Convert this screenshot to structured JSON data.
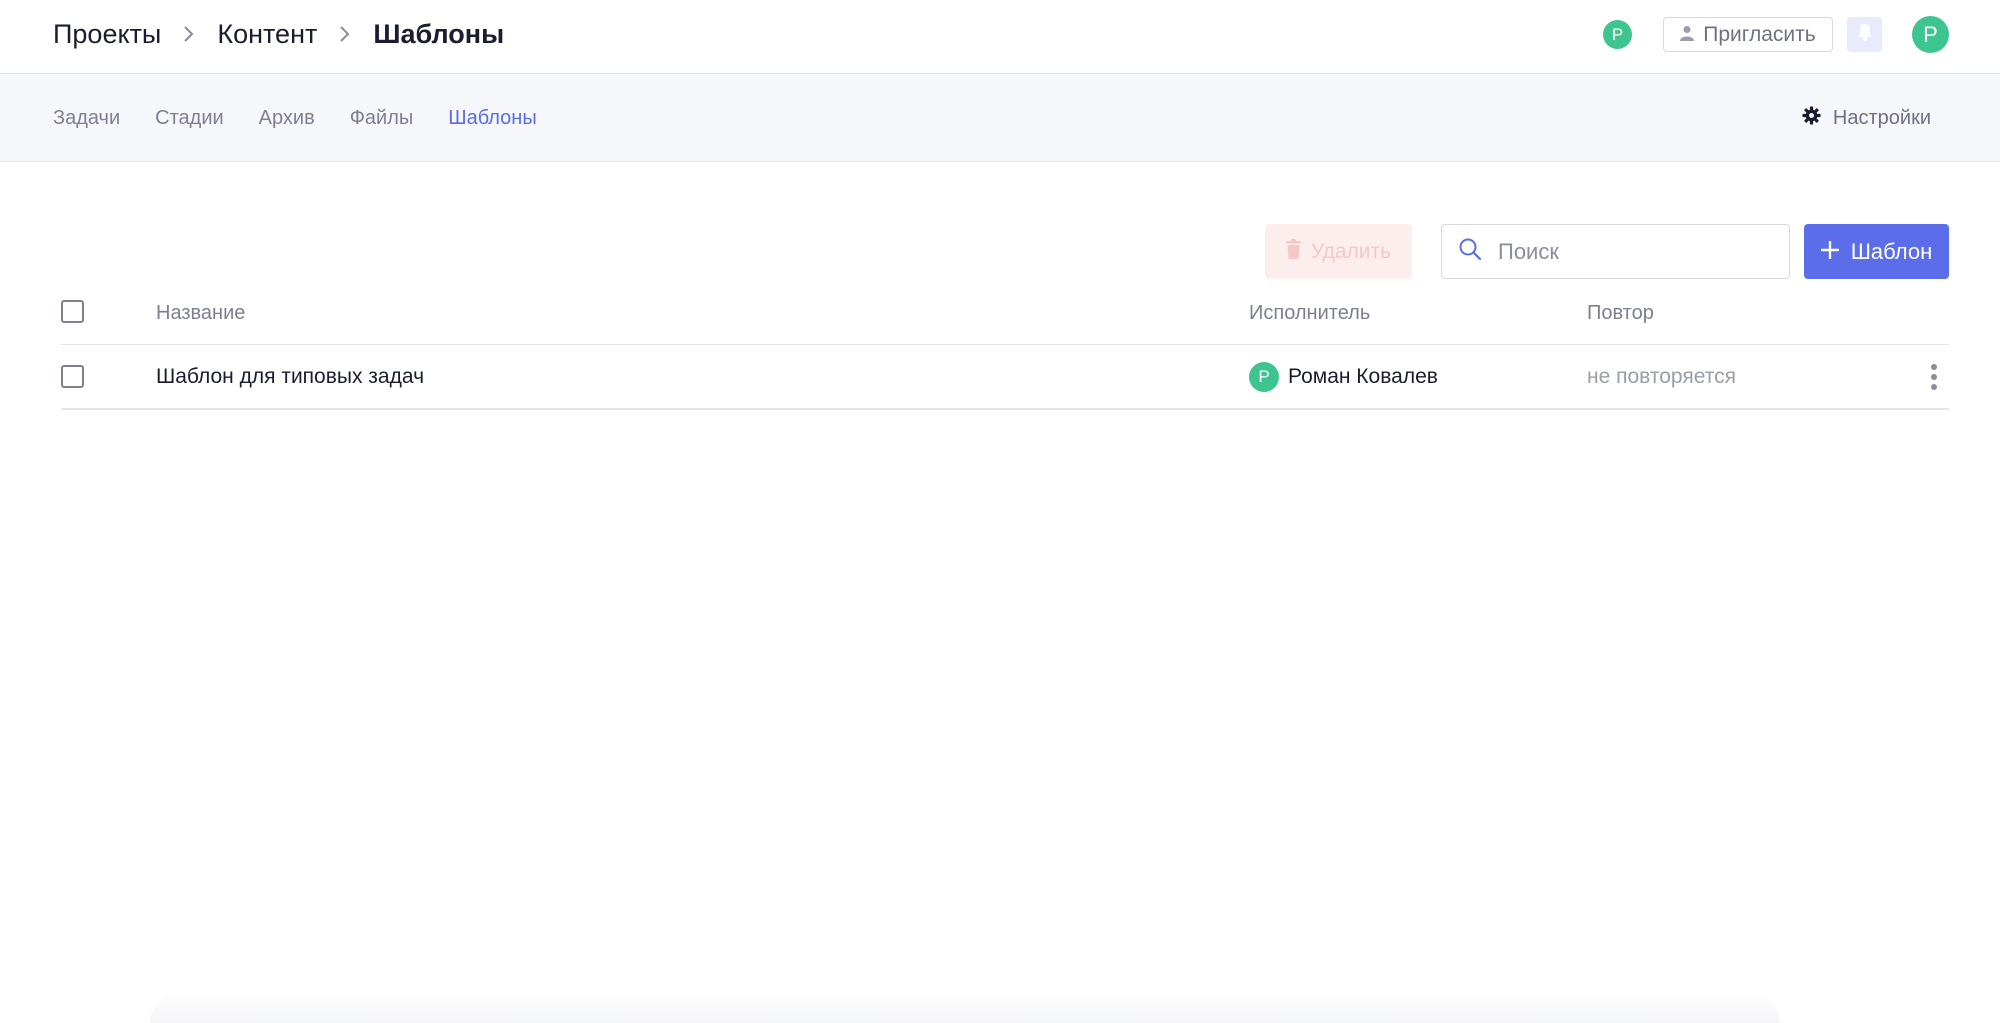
{
  "breadcrumb": {
    "items": [
      "Проекты",
      "Контент",
      "Шаблоны"
    ]
  },
  "header": {
    "presence_avatar": "Р",
    "invite_label": "Пригласить",
    "user_avatar": "Р"
  },
  "tabs": {
    "items": [
      "Задачи",
      "Стадии",
      "Архив",
      "Файлы",
      "Шаблоны"
    ],
    "active": "Шаблоны"
  },
  "settings_label": "Настройки",
  "toolbar": {
    "delete_label": "Удалить",
    "search_placeholder": "Поиск",
    "add_label": "Шаблон"
  },
  "table": {
    "columns": [
      "Название",
      "Исполнитель",
      "Повтор"
    ],
    "rows": [
      {
        "name": "Шаблон для типовых задач",
        "assignee": "Роман Ковалев",
        "assignee_initial": "Р",
        "repeat": "не повторяется"
      }
    ]
  },
  "colors": {
    "accent": "#5b6de8",
    "active_tab": "#5a6ce6",
    "avatar": "#3ec48e",
    "delete_bg": "#fdeeee"
  },
  "icons": [
    "chevron-right-icon",
    "user-icon",
    "bell-icon",
    "gear-icon",
    "trash-icon",
    "search-icon",
    "plus-icon",
    "kebab-menu-icon"
  ]
}
